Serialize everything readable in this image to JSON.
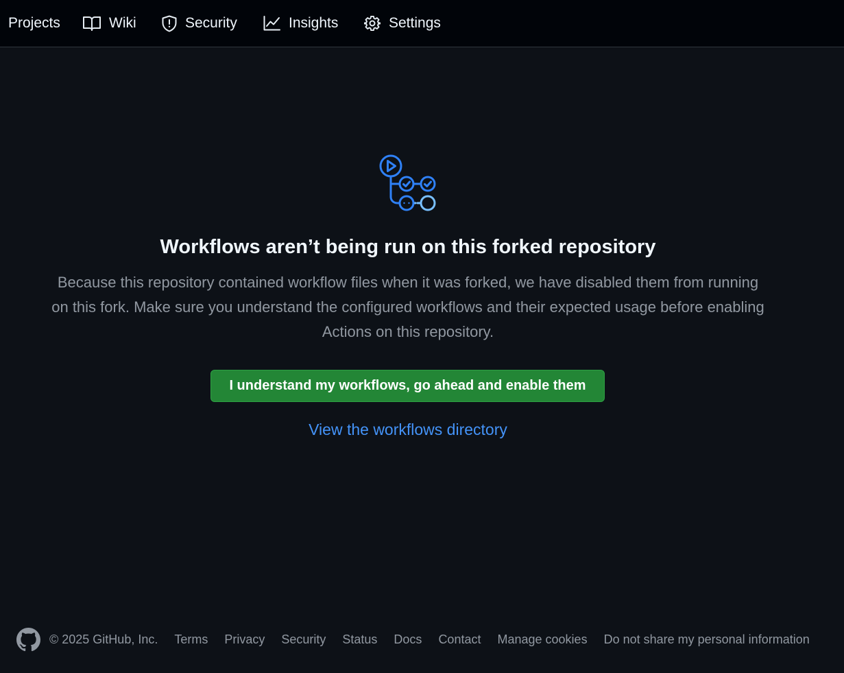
{
  "nav": {
    "items": [
      {
        "label": "Projects",
        "icon": "table-icon"
      },
      {
        "label": "Wiki",
        "icon": "book-icon"
      },
      {
        "label": "Security",
        "icon": "shield-icon"
      },
      {
        "label": "Insights",
        "icon": "graph-icon"
      },
      {
        "label": "Settings",
        "icon": "gear-icon"
      }
    ]
  },
  "main": {
    "headline": "Workflows aren’t being run on this forked repository",
    "description": "Because this repository contained workflow files when it was forked, we have disabled them from running on this fork. Make sure you understand the configured workflows and their expected usage before enabling Actions on this repository.",
    "enable_button": "I understand my workflows, go ahead and enable them",
    "view_link": "View the workflows directory",
    "icon": "workflow-icon"
  },
  "footer": {
    "copyright": "© 2025 GitHub, Inc.",
    "links": [
      "Terms",
      "Privacy",
      "Security",
      "Status",
      "Docs",
      "Contact",
      "Manage cookies",
      "Do not share my personal information"
    ]
  },
  "colors": {
    "background": "#0d1117",
    "nav_background": "#010409",
    "primary_button": "#238636",
    "link": "#4493f8",
    "muted_text": "#9198a1"
  }
}
